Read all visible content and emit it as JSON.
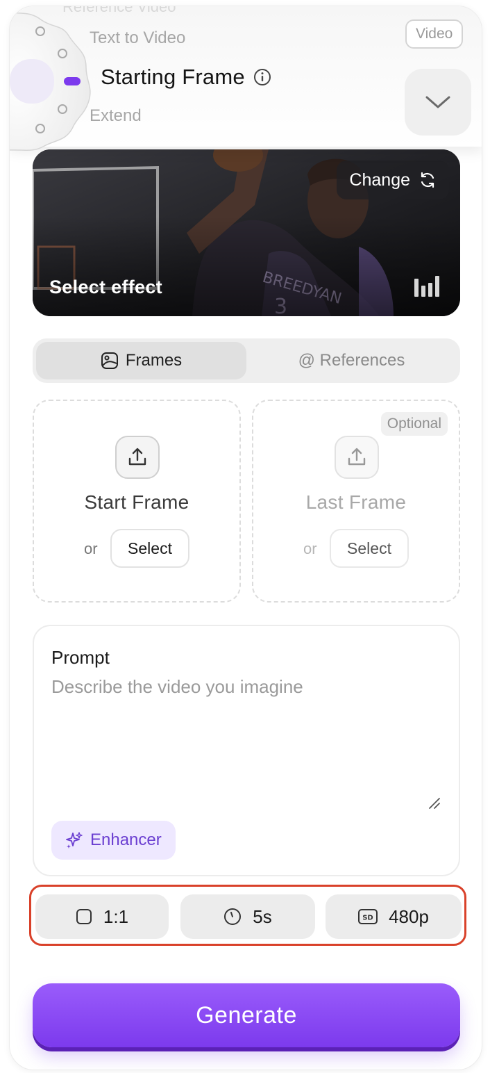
{
  "mode_selector": {
    "faded_above": "Reference Video",
    "previous": "Text to Video",
    "current": "Starting Frame",
    "next": "Extend",
    "badge": "Video",
    "accent_color": "#7c3aed"
  },
  "effect": {
    "change_label": "Change",
    "select_label": "Select effect"
  },
  "tabs": [
    {
      "label": "Frames",
      "active": true
    },
    {
      "label": "@ References",
      "active": false
    }
  ],
  "frames": {
    "start": {
      "title": "Start Frame",
      "or_text": "or",
      "select_label": "Select"
    },
    "last": {
      "title": "Last Frame",
      "or_text": "or",
      "select_label": "Select",
      "badge": "Optional"
    }
  },
  "prompt": {
    "label": "Prompt",
    "placeholder": "Describe the video you imagine",
    "value": "",
    "enhancer_label": "Enhancer"
  },
  "settings": {
    "aspect_ratio": "1:1",
    "duration": "5s",
    "resolution": "480p",
    "highlight_color": "#d9412a"
  },
  "generate_label": "Generate"
}
